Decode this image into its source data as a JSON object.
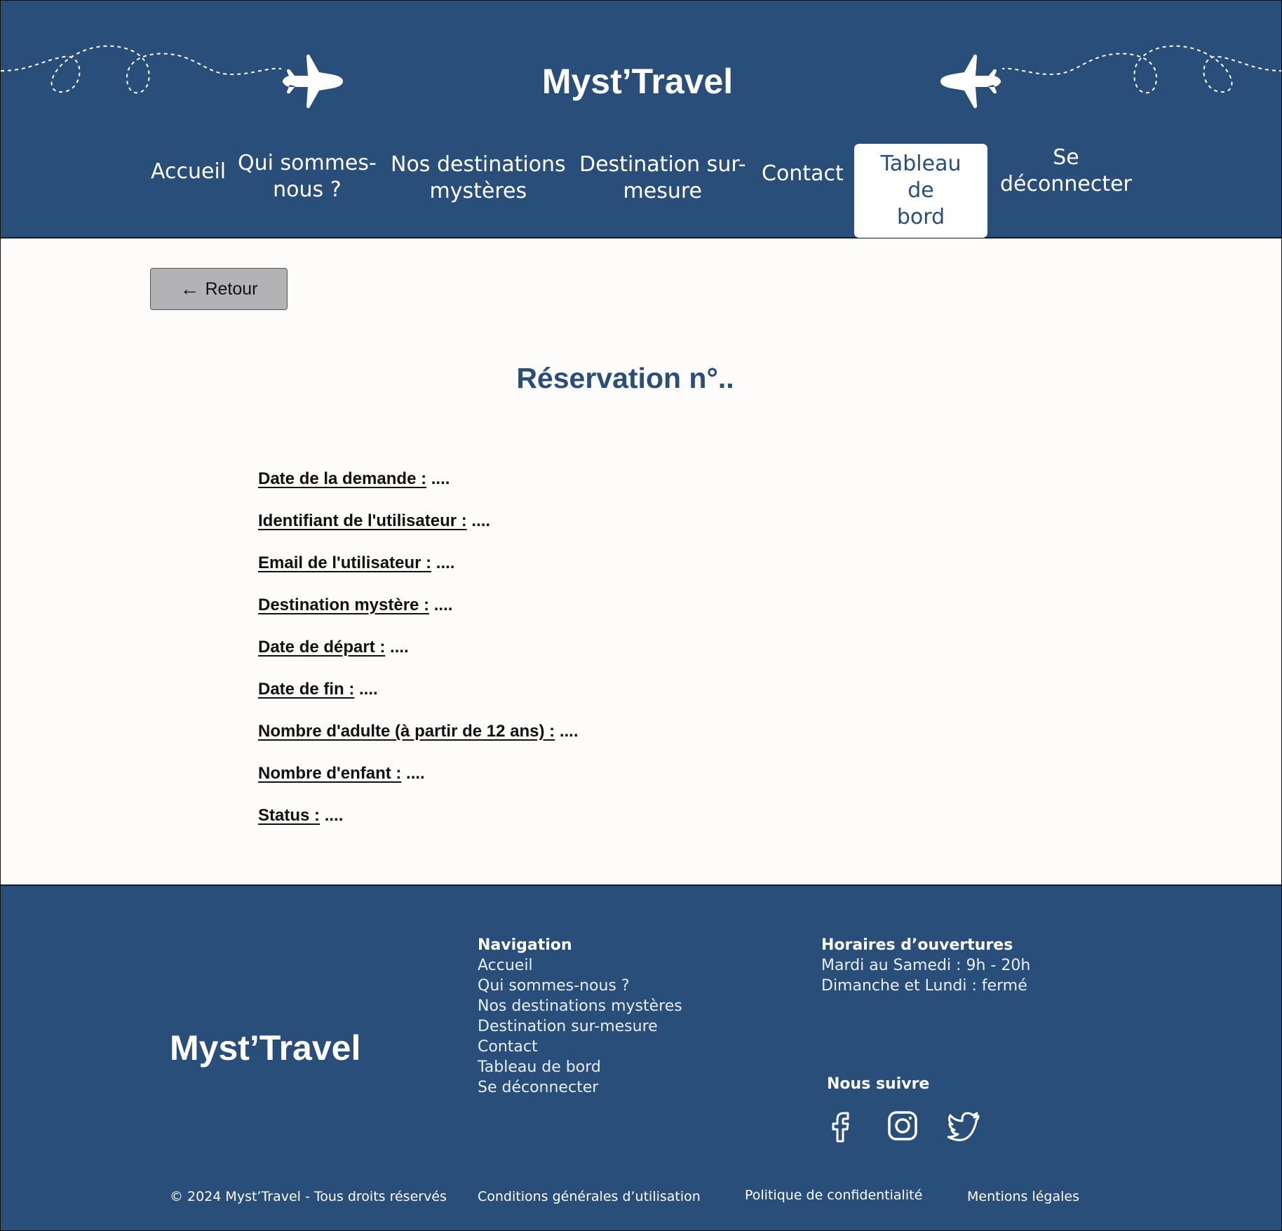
{
  "header": {
    "brand": "Myst’Travel",
    "nav": [
      {
        "label_lines": [
          "Accueil"
        ]
      },
      {
        "label_lines": [
          "Qui sommes-",
          "nous ?"
        ]
      },
      {
        "label_lines": [
          "Nos destinations",
          "mystères"
        ]
      },
      {
        "label_lines": [
          "Destination sur-",
          "mesure"
        ]
      },
      {
        "label_lines": [
          "Contact"
        ]
      },
      {
        "label_lines": [
          "Tableau de",
          "bord"
        ],
        "active": true
      },
      {
        "label_lines": [
          "Se",
          "déconnecter"
        ]
      }
    ]
  },
  "main": {
    "back_label": "Retour",
    "title": "Réservation n°..",
    "fields": [
      {
        "label": "Date de la demande :",
        "value": "...."
      },
      {
        "label": "Identifiant de l'utilisateur :",
        "value": "...."
      },
      {
        "label": "Email de l'utilisateur :",
        "value": "...."
      },
      {
        "label": "Destination mystère :",
        "value": "...."
      },
      {
        "label": "Date de départ :",
        "value": "...."
      },
      {
        "label": "Date de fin :",
        "value": "...."
      },
      {
        "label": "Nombre d'adulte (à partir de 12 ans) :",
        "value": "...."
      },
      {
        "label": "Nombre d'enfant :",
        "value": "...."
      },
      {
        "label": "Status :",
        "value": "...."
      }
    ]
  },
  "footer": {
    "brand": "Myst’Travel",
    "navigation_title": "Navigation",
    "navigation_links": [
      "Accueil",
      "Qui sommes-nous ?",
      "Nos destinations mystères",
      "Destination sur-mesure",
      "Contact",
      "Tableau de bord",
      "Se déconnecter"
    ],
    "hours_title": "Horaires d’ouvertures",
    "hours": [
      "Mardi au Samedi : 9h - 20h",
      "Dimanche et Lundi : fermé"
    ],
    "follow_title": "Nous suivre",
    "socials": [
      "facebook-icon",
      "instagram-icon",
      "twitter-icon"
    ],
    "copyright": "© 2024 Myst’Travel - Tous droits réservés",
    "terms": "Conditions générales d’utilisation",
    "privacy": "Politique de confidentialité",
    "legal": "Mentions légales"
  },
  "colors": {
    "primary": "#284e79",
    "background": "#fdfcfa",
    "button_grey": "#b3b2b4"
  }
}
